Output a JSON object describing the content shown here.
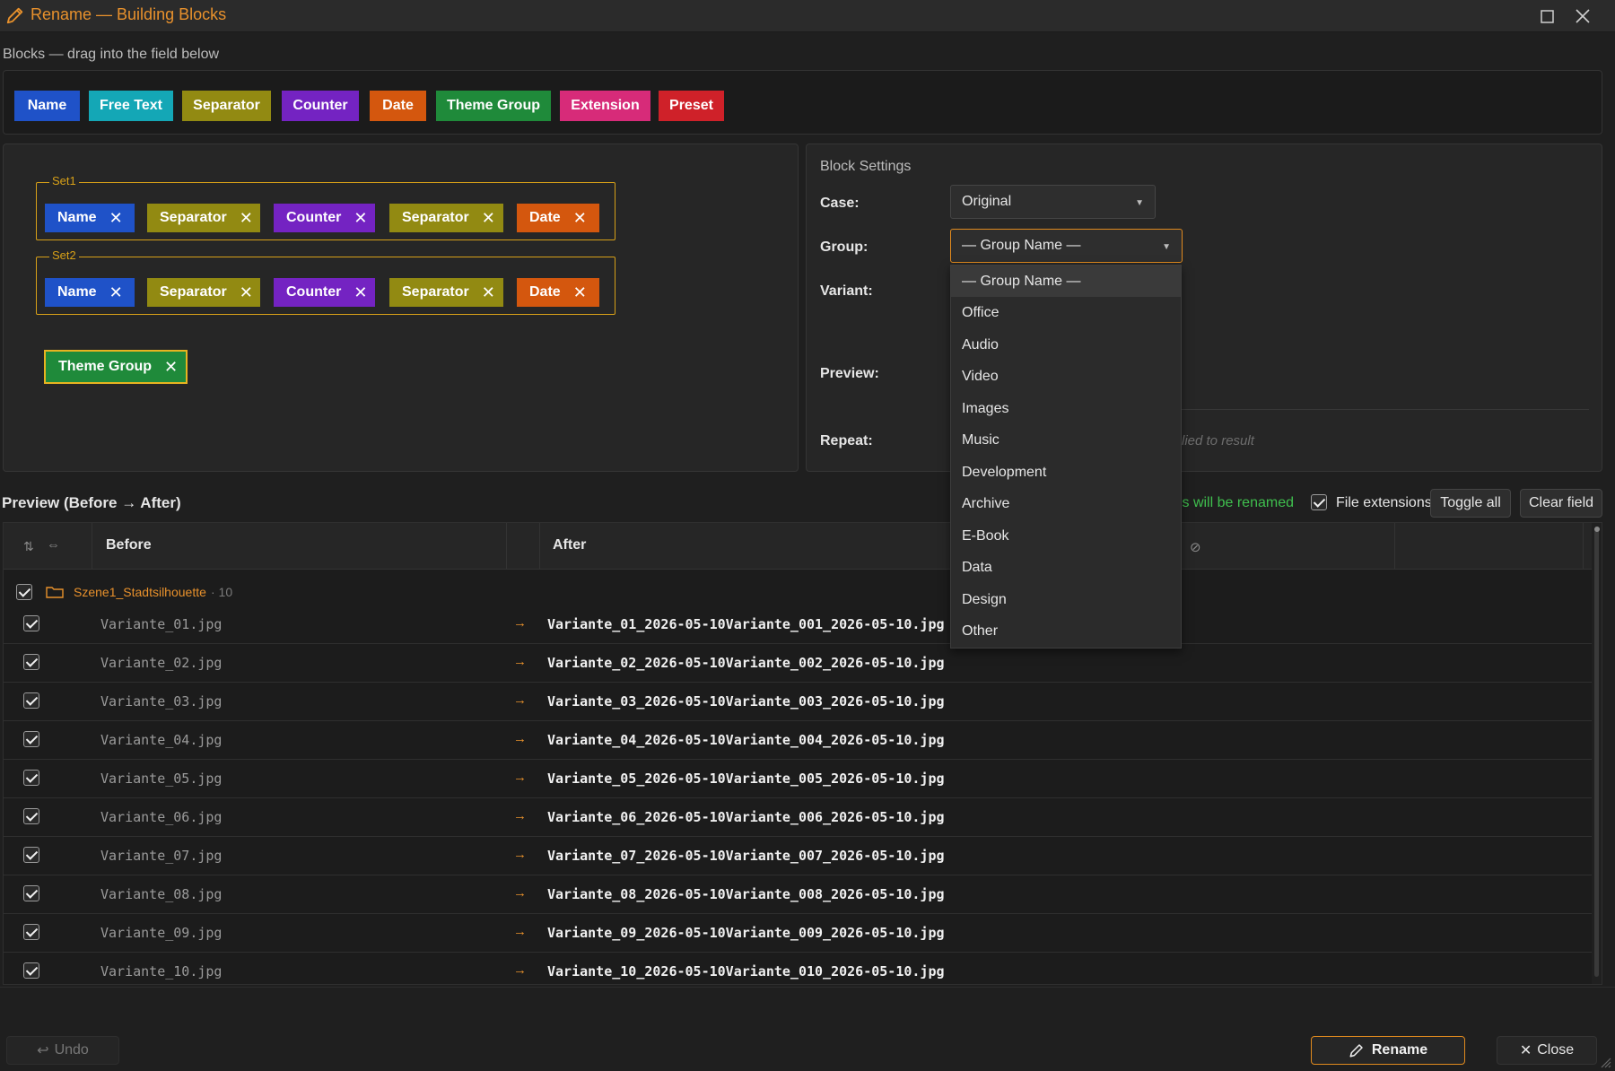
{
  "window": {
    "title": "Rename — Building Blocks",
    "icon": "pencil-icon",
    "accent": "#e8912c"
  },
  "palette": {
    "caption": "Blocks — drag into the field below",
    "blocks": [
      {
        "label": "Name",
        "color": "#1f52c8"
      },
      {
        "label": "Free Text",
        "color": "#14a7b6"
      },
      {
        "label": "Separator",
        "color": "#928a12"
      },
      {
        "label": "Counter",
        "color": "#7423c2"
      },
      {
        "label": "Date",
        "color": "#d4570e"
      },
      {
        "label": "Theme Group",
        "color": "#1f8a3a"
      },
      {
        "label": "Extension",
        "color": "#d72b79"
      },
      {
        "label": "Preset",
        "color": "#cf2129"
      }
    ]
  },
  "build_field": {
    "sets": [
      {
        "label": "Set1",
        "blocks": [
          "Name",
          "Separator",
          "Counter",
          "Separator",
          "Date"
        ]
      },
      {
        "label": "Set2",
        "blocks": [
          "Name",
          "Separator",
          "Counter",
          "Separator",
          "Date"
        ]
      }
    ],
    "loose_block": {
      "label": "Theme Group",
      "selected": true
    }
  },
  "settings": {
    "title": "Block Settings",
    "case_label": "Case:",
    "case_value": "Original",
    "group_label": "Group:",
    "group_value": "— Group Name —",
    "variant_label": "Variant:",
    "preview_label": "Preview:",
    "repeat_label": "Repeat:",
    "repeat_hint": "lied to result",
    "group_options": [
      "— Group Name —",
      "Office",
      "Audio",
      "Video",
      "Images",
      "Music",
      "Development",
      "Archive",
      "E-Book",
      "Data",
      "Design",
      "Other"
    ],
    "group_selected_index": 0
  },
  "preview": {
    "title": "Preview (Before → After)",
    "rename_count": "es will be renamed",
    "file_extensions_label": "File extensions",
    "file_extensions_checked": true,
    "toggle_all": "Toggle all",
    "clear_field": "Clear field",
    "columns": {
      "before": "Before",
      "after": "After"
    },
    "group": {
      "name": "Szene1_Stadtsilhouette",
      "count": "· 10",
      "checked": true
    },
    "rows": [
      {
        "before": "Variante_01.jpg",
        "after": "Variante_01_2026-05-10Variante_001_2026-05-10.jpg",
        "checked": true
      },
      {
        "before": "Variante_02.jpg",
        "after": "Variante_02_2026-05-10Variante_002_2026-05-10.jpg",
        "checked": true
      },
      {
        "before": "Variante_03.jpg",
        "after": "Variante_03_2026-05-10Variante_003_2026-05-10.jpg",
        "checked": true
      },
      {
        "before": "Variante_04.jpg",
        "after": "Variante_04_2026-05-10Variante_004_2026-05-10.jpg",
        "checked": true
      },
      {
        "before": "Variante_05.jpg",
        "after": "Variante_05_2026-05-10Variante_005_2026-05-10.jpg",
        "checked": true
      },
      {
        "before": "Variante_06.jpg",
        "after": "Variante_06_2026-05-10Variante_006_2026-05-10.jpg",
        "checked": true
      },
      {
        "before": "Variante_07.jpg",
        "after": "Variante_07_2026-05-10Variante_007_2026-05-10.jpg",
        "checked": true
      },
      {
        "before": "Variante_08.jpg",
        "after": "Variante_08_2026-05-10Variante_008_2026-05-10.jpg",
        "checked": true
      },
      {
        "before": "Variante_09.jpg",
        "after": "Variante_09_2026-05-10Variante_009_2026-05-10.jpg",
        "checked": true
      },
      {
        "before": "Variante_10.jpg",
        "after": "Variante_10_2026-05-10Variante_010_2026-05-10.jpg",
        "checked": true
      }
    ],
    "arrow": "→"
  },
  "footer": {
    "undo": "Undo",
    "rename": "Rename",
    "close": "Close"
  }
}
